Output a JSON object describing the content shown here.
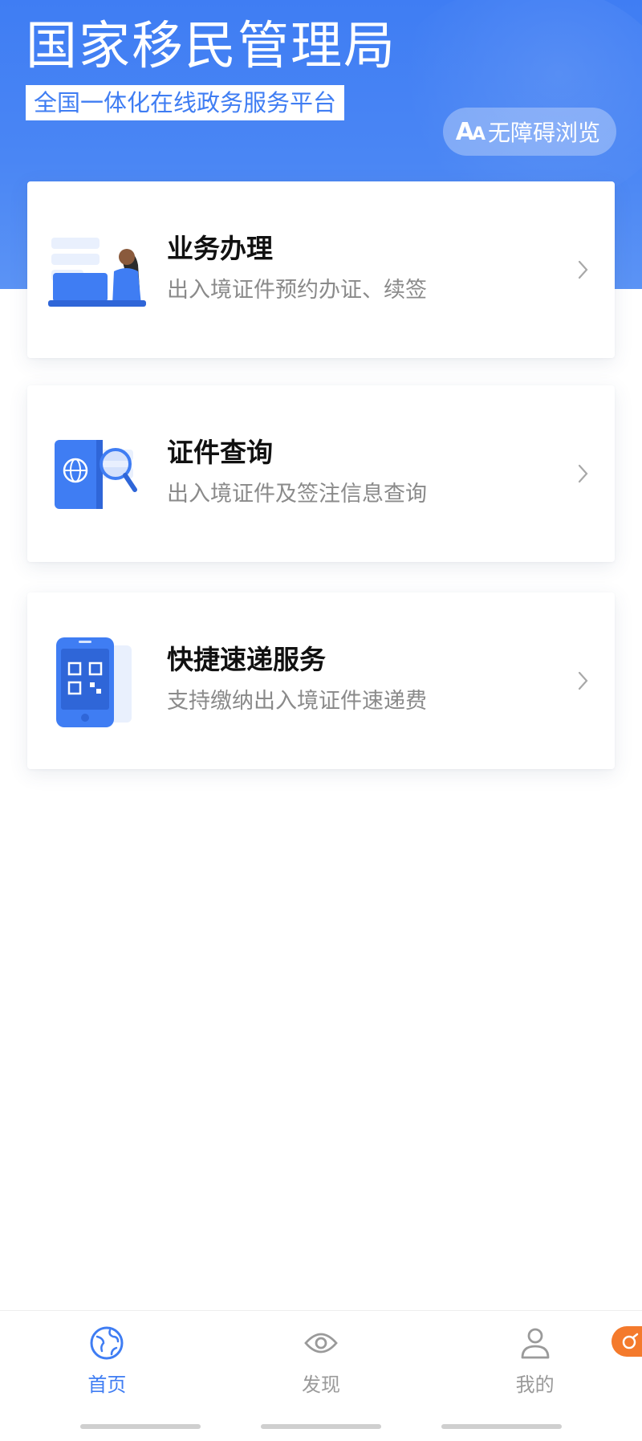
{
  "header": {
    "title": "国家移民管理局",
    "subtitle": "全国一体化在线政务服务平台",
    "accessibility_label": "无障碍浏览",
    "accessibility_icon": "font-size-icon"
  },
  "services": [
    {
      "title": "业务办理",
      "desc": "出入境证件预约办证、续签",
      "icon": "laptop-person-icon"
    },
    {
      "title": "证件查询",
      "desc": "出入境证件及签注信息查询",
      "icon": "passport-search-icon"
    },
    {
      "title": "快捷速递服务",
      "desc": "支持缴纳出入境证件速递费",
      "icon": "phone-qrcode-icon"
    }
  ],
  "tabbar": [
    {
      "label": "首页",
      "icon": "globe-icon",
      "active": true
    },
    {
      "label": "发现",
      "icon": "eye-icon",
      "active": false
    },
    {
      "label": "我的",
      "icon": "user-icon",
      "active": false
    }
  ],
  "colors": {
    "brand": "#3f7df3",
    "card_title": "#111111",
    "card_desc": "#8a8a8a",
    "tab_inactive": "#9a9a9a",
    "float_button": "#f47a2c"
  }
}
